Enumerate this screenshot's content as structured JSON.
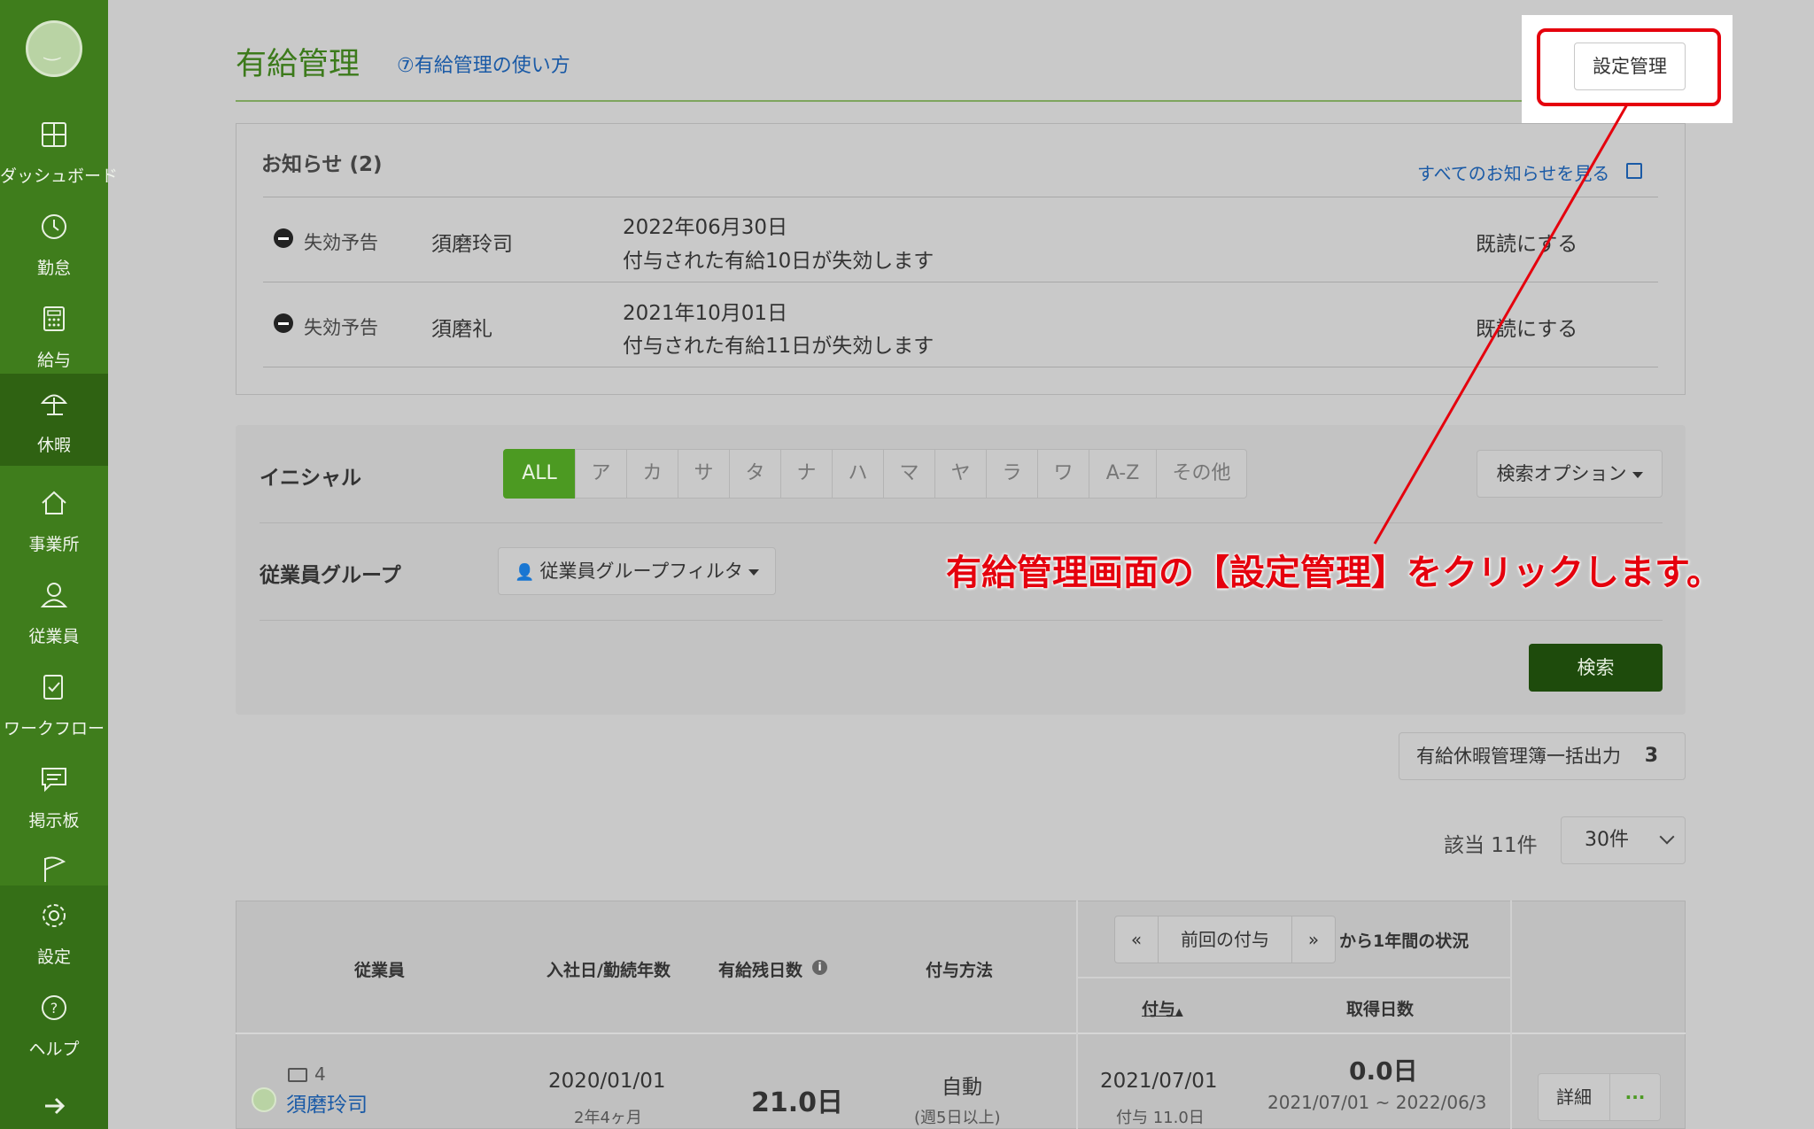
{
  "sidebar": {
    "items": [
      {
        "label": "ダッシュボード",
        "icon": "dashboard-icon"
      },
      {
        "label": "勤怠",
        "icon": "clock-icon"
      },
      {
        "label": "給与",
        "icon": "calculator-icon"
      },
      {
        "label": "休暇",
        "icon": "umbrella-icon"
      },
      {
        "label": "事業所",
        "icon": "home-icon"
      },
      {
        "label": "従業員",
        "icon": "person-icon"
      },
      {
        "label": "ワークフロー",
        "icon": "workflow-icon"
      },
      {
        "label": "掲示板",
        "icon": "message-icon"
      },
      {
        "label": "",
        "icon": "flag-icon"
      },
      {
        "label": "設定",
        "icon": "gear-icon"
      },
      {
        "label": "ヘルプ",
        "icon": "help-icon"
      }
    ],
    "active_index": 3
  },
  "header": {
    "title": "有給管理",
    "help_link": "⑦有給管理の使い方",
    "settings_button": "設定管理"
  },
  "notices": {
    "title": "お知らせ (2)",
    "view_all": "すべてのお知らせを見る",
    "rows": [
      {
        "type": "失効予告",
        "name": "須磨玲司",
        "date": "2022年06月30日",
        "message": "付与された有給10日が失効します",
        "action": "既読にする"
      },
      {
        "type": "失効予告",
        "name": "須磨礼",
        "date": "2021年10月01日",
        "message": "付与された有給11日が失効します",
        "action": "既読にする"
      }
    ]
  },
  "filter": {
    "initial_label": "イニシャル",
    "initials": [
      "ALL",
      "ア",
      "カ",
      "サ",
      "タ",
      "ナ",
      "ハ",
      "マ",
      "ヤ",
      "ラ",
      "ワ",
      "A-Z",
      "その他"
    ],
    "active_initial": "ALL",
    "search_options": "検索オプション",
    "group_label": "従業員グループ",
    "group_filter": "従業員グループフィルタ",
    "search_button": "検索"
  },
  "export": {
    "label": "有給休暇管理簿一括出力",
    "count": "3"
  },
  "results": {
    "count_text": "該当 11件",
    "per_page": "30件"
  },
  "table": {
    "headers": {
      "employee": "従業員",
      "hire_date": "入社日/勤続年数",
      "remaining": "有給残日数",
      "grant_method": "付与方法",
      "prev_pager": "«",
      "prev_grant": "前回の付与",
      "next_pager": "»",
      "period_suffix": "から1年間の状況",
      "grant": "付与",
      "acquired": "取得日数"
    },
    "rows": [
      {
        "emp_no": "4",
        "name": "須磨玲司",
        "hire_date": "2020/01/01",
        "tenure": "2年4ヶ月",
        "remaining": "21.0日",
        "method": "自動",
        "method_note": "(週5日以上)",
        "grant_date": "2021/07/01",
        "grant_days": "付与 11.0日",
        "acquired_days": "0.0日",
        "period": "2021/07/01 ~ 2022/06/3",
        "detail_button": "詳細",
        "more_button": "···"
      }
    ]
  },
  "annotation": "有給管理画面の【設定管理】をクリックします。",
  "colors": {
    "brand_green": "#3f7d1c",
    "active_green": "#4c9a22",
    "search_green": "#1e4b0c",
    "annotation_red": "#e5000d",
    "link_blue": "#1a5aa6"
  }
}
